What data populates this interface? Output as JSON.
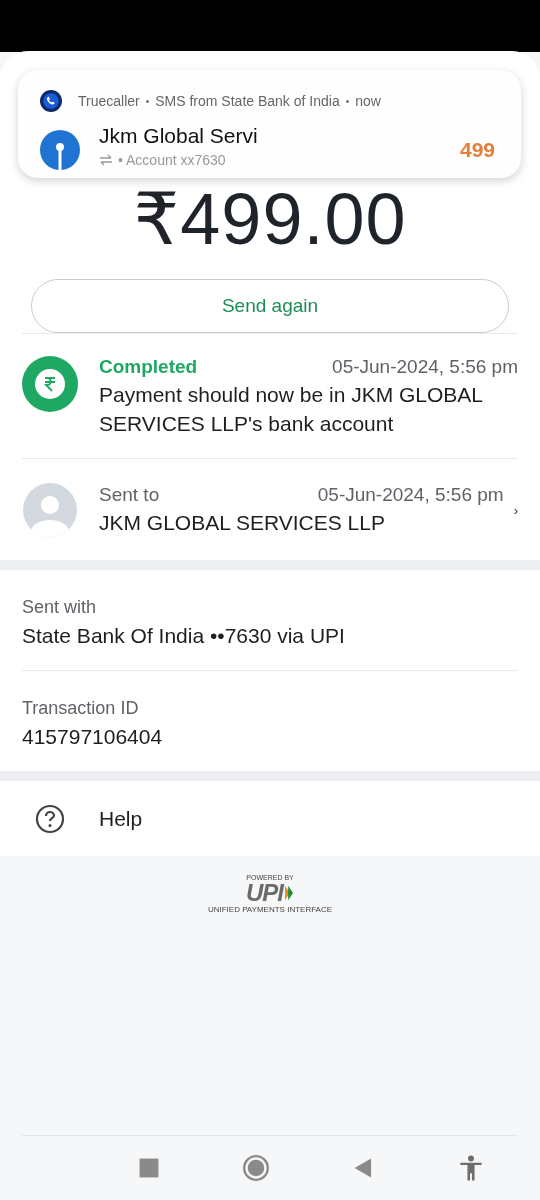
{
  "notification": {
    "app": "Truecaller",
    "source": "SMS from State Bank of India",
    "time": "now",
    "separator": "•",
    "sender": "Jkm Global Servi",
    "subtitle": "• Account xx7630",
    "amount": "499"
  },
  "amount": "₹499.00",
  "send_again": "Send again",
  "status": {
    "label": "Completed",
    "time": "05-Jun-2024, 5:56 pm",
    "message": "Payment should now be in JKM GLOBAL SERVICES LLP's bank account"
  },
  "recipient": {
    "label": "Sent to",
    "time": "05-Jun-2024, 5:56 pm",
    "name": "JKM GLOBAL SERVICES LLP",
    "chevron": "›"
  },
  "details": [
    {
      "label": "Sent with",
      "value": "State Bank Of India ••7630 via UPI"
    },
    {
      "label": "Transaction ID",
      "value": "415797106404"
    }
  ],
  "help": "Help",
  "upi": {
    "powered": "POWERED BY",
    "name": "UPI",
    "tagline": "UNIFIED PAYMENTS INTERFACE"
  }
}
